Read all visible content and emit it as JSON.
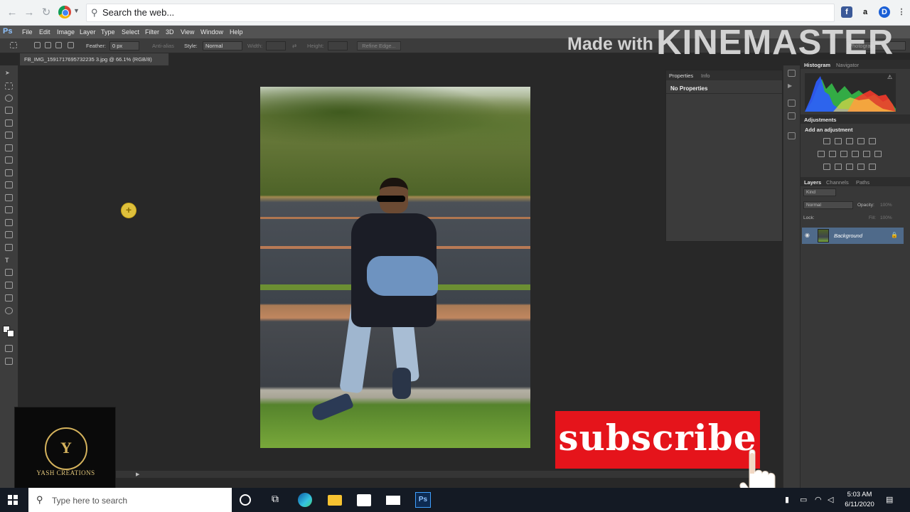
{
  "browser": {
    "search_text": "Search the web...",
    "extensions": [
      "facebook-icon",
      "amazon-icon",
      "dashlane-icon",
      "more-icon"
    ]
  },
  "photoshop": {
    "logo": "Ps",
    "menu": [
      "File",
      "Edit",
      "Image",
      "Layer",
      "Type",
      "Select",
      "Filter",
      "3D",
      "View",
      "Window",
      "Help"
    ],
    "options": {
      "feather_label": "Feather:",
      "feather_value": "0 px",
      "antialias_label": "Anti-alias",
      "style_label": "Style:",
      "style_value": "Normal",
      "width_label": "Width:",
      "height_label": "Height:",
      "refine_edge": "Refine Edge...",
      "workspace": "Photograp"
    },
    "document_tab": "FB_IMG_1591717695732235 3.jpg @ 66.1% (RGB/8)",
    "properties_panel": {
      "tabs": [
        "Properties",
        "Info"
      ],
      "message": "No Properties"
    },
    "histogram_panel": {
      "tabs": [
        "Histogram",
        "Navigator"
      ]
    },
    "adjustments_panel": {
      "title": "Adjustments",
      "subtitle": "Add an adjustment"
    },
    "layers_panel": {
      "tabs": [
        "Layers",
        "Channels",
        "Paths"
      ],
      "kind_filter": "Kind",
      "blend_mode": "Normal",
      "opacity_label": "Opacity:",
      "opacity_value": "100%",
      "lock_label": "Lock:",
      "fill_label": "Fill:",
      "fill_value": "100%",
      "layers": [
        {
          "name": "Background",
          "visible": true,
          "locked": true
        }
      ]
    }
  },
  "overlay": {
    "watermark_made": "Made with",
    "watermark_brand": "KINEMASTER",
    "subscribe": "subscribe",
    "channel_logo_letter": "Y",
    "channel_name": "YASH CREATIONS"
  },
  "taskbar": {
    "search_placeholder": "Type here to search",
    "apps": [
      "cortana-icon",
      "task-view-icon",
      "edge-icon",
      "file-explorer-icon",
      "store-icon",
      "mail-icon",
      "photoshop-icon"
    ],
    "time": "5:03 AM",
    "date": "6/11/2020"
  },
  "colors": {
    "ps_background": "#282828",
    "ps_panel": "#383838",
    "subscribe_red": "#e5141b",
    "taskbar": "#141a24",
    "layer_selected": "#4f6a8a"
  }
}
